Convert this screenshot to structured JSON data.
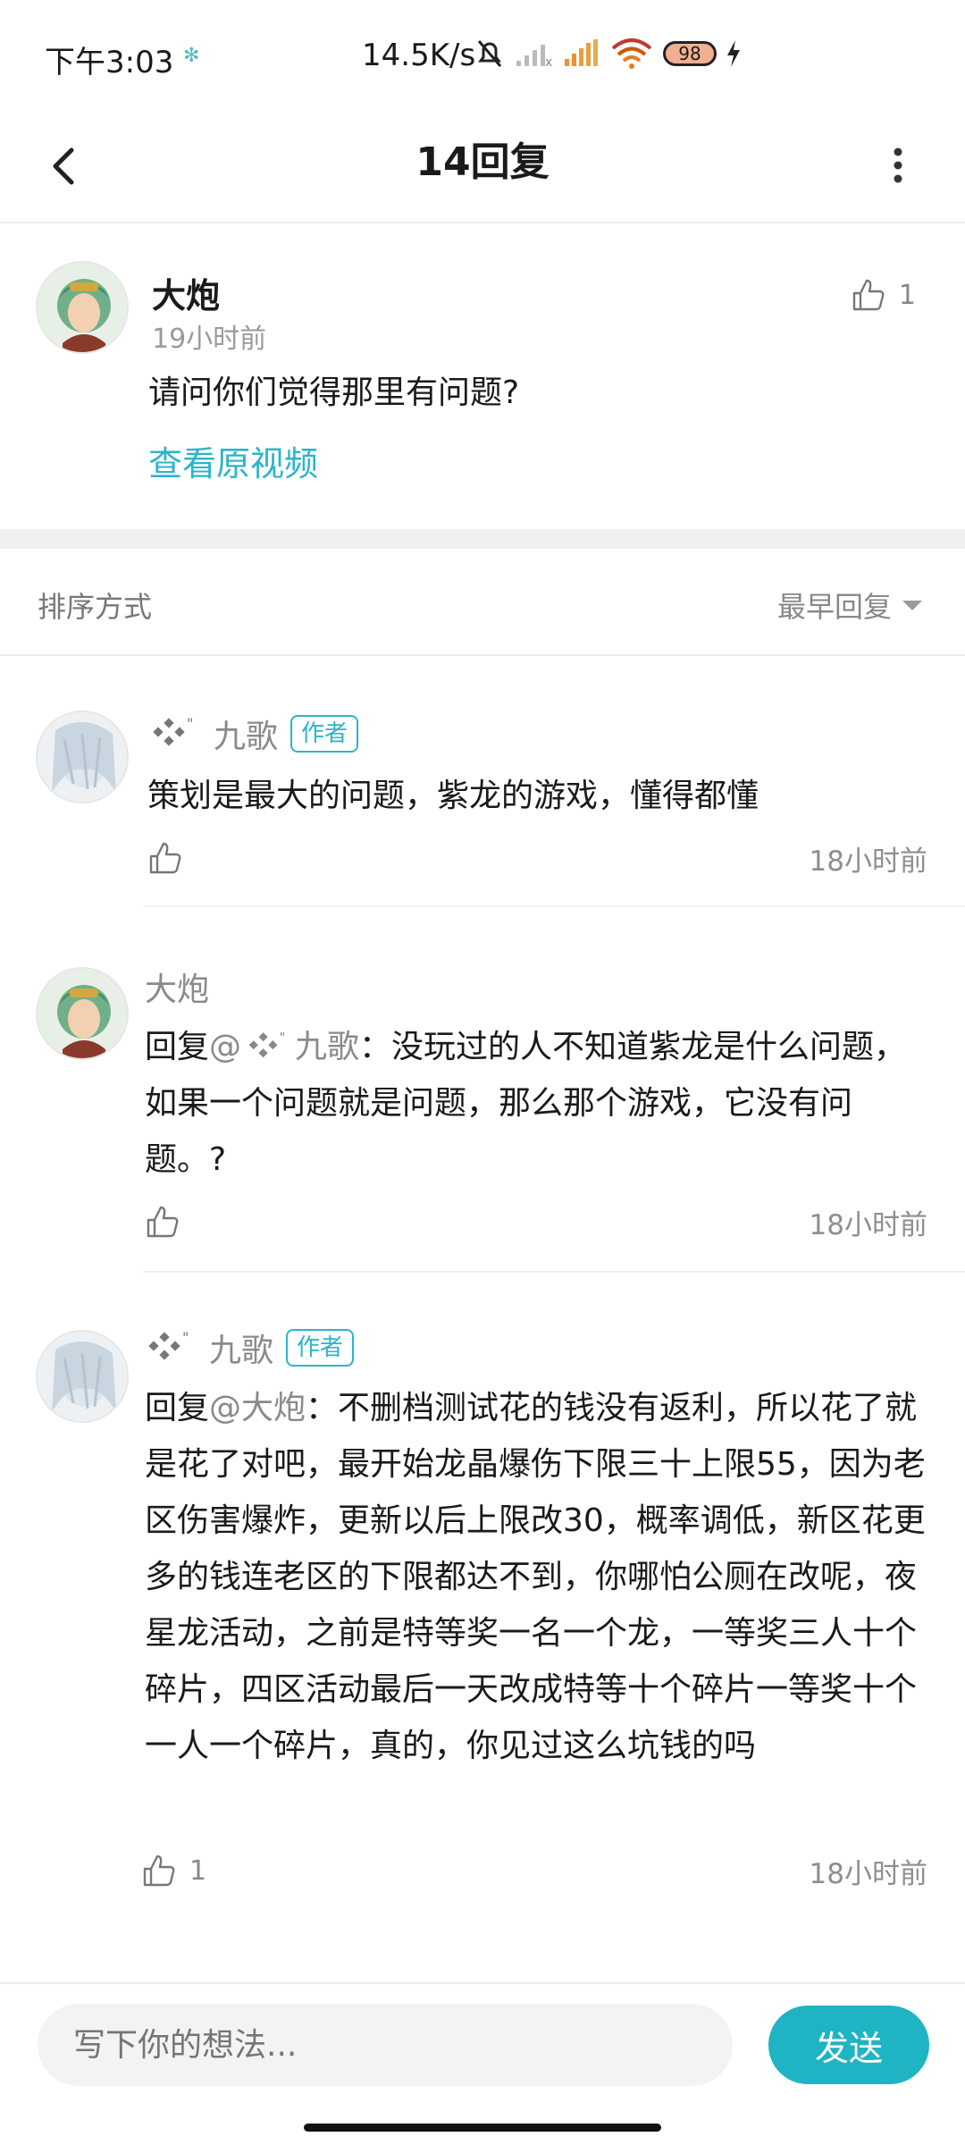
{
  "status_bar": {
    "time": "下午3:03",
    "net_speed": "14.5K/s",
    "battery": "98"
  },
  "header": {
    "title": "14回复"
  },
  "post": {
    "author": "大炮",
    "time": "19小时前",
    "likes": "1",
    "text": "请问你们觉得那里有问题?",
    "view_video": "查看原视频"
  },
  "sort": {
    "label": "排序方式",
    "value": "最早回复"
  },
  "comments": [
    {
      "author": "九歌",
      "badge": "作者",
      "text": "策划是最大的问题，紫龙的游戏，懂得都懂",
      "likes": "",
      "time": "18小时前"
    },
    {
      "author": "大炮",
      "reply_prefix": "回复",
      "mention": "@",
      "mention_name": "九歌",
      "text": "：没玩过的人不知道紫龙是什么问题，如果一个问题就是问题，那么那个游戏，它没有问题。?",
      "likes": "",
      "time": "18小时前"
    },
    {
      "author": "九歌",
      "badge": "作者",
      "reply_prefix": "回复",
      "mention": "@大炮",
      "text": "：不删档测试花的钱没有返利，所以花了就是花了对吧，最开始龙晶爆伤下限三十上限55，因为老区伤害爆炸，更新以后上限改30，概率调低，新区花更多的钱连老区的下限都达不到，你哪怕公厕在改呢，夜星龙活动，之前是特等奖一名一个龙，一等奖三人十个碎片，四区活动最后一天改成特等十个碎片一等奖十个一人一个碎片，真的，你见过这么坑钱的吗",
      "likes": "1",
      "time": "18小时前"
    }
  ],
  "composer": {
    "placeholder": "写下你的想法...",
    "send_label": "发送"
  }
}
